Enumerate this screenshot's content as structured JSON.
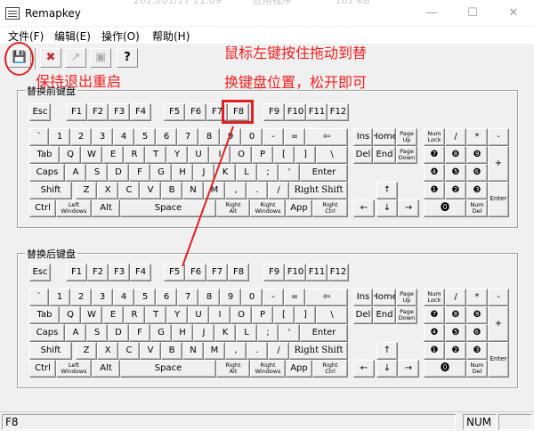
{
  "window": {
    "title": "Remapkey",
    "ghost_text": "2025/01/17 11:09          应用程序              161 KB"
  },
  "menu": [
    {
      "label": "文件(F)"
    },
    {
      "label": "编辑(E)"
    },
    {
      "label": "操作(O)"
    },
    {
      "label": "帮助(H)"
    }
  ],
  "toolbar": [
    {
      "name": "save-exit-button",
      "icon": "save-exit-icon",
      "glyph": "💾"
    },
    {
      "name": "exit-no-save-button",
      "icon": "exit-no-save-icon",
      "glyph": "✖"
    },
    {
      "name": "remap-button",
      "icon": "remap-icon",
      "glyph": "↗"
    },
    {
      "name": "scancode-button",
      "icon": "scancode-icon",
      "glyph": "▣"
    },
    {
      "name": "help-button",
      "icon": "help-icon",
      "glyph": "?"
    }
  ],
  "annotations": {
    "drag_hint_line1": "鼠标左键按住拖动到替",
    "drag_hint_line2": "换键盘位置，松开即可",
    "save_hint": "保持退出重启"
  },
  "groups": {
    "base": "替换前键盘",
    "remap": "替换后键盘"
  },
  "highlighted_key": "F8",
  "statusbar": {
    "key": "F8",
    "num": "NUM"
  },
  "colors": {
    "annotation": "#e02020",
    "face": "#f0f0f0"
  }
}
